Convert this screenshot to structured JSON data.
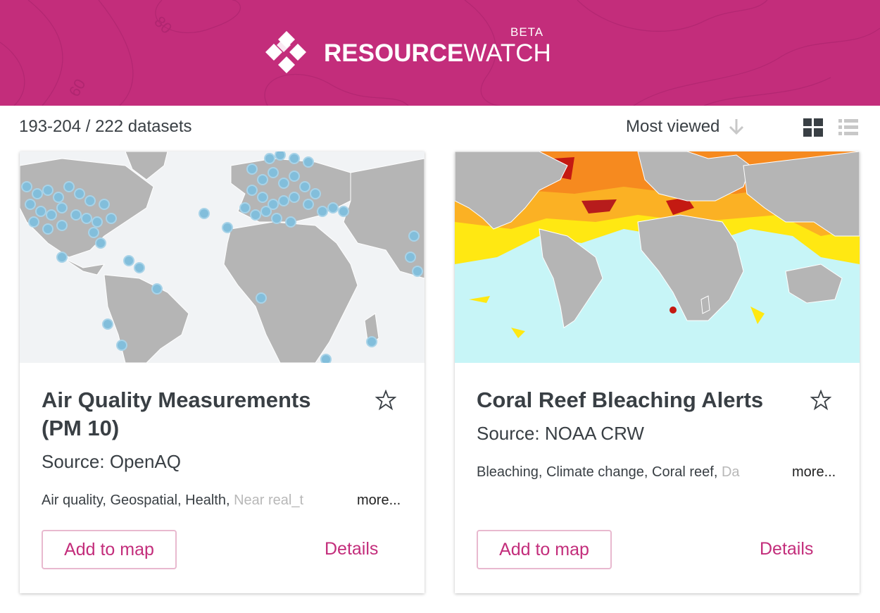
{
  "header": {
    "brand_bold": "RESOURCE",
    "brand_light": "WATCH",
    "badge": "BETA",
    "background": "#c32d7b",
    "contour_labels": [
      "80",
      "60"
    ]
  },
  "toolbar": {
    "count": "193-204 / 222 datasets",
    "sort_label": "Most viewed",
    "sort_icon": "arrow-down-icon",
    "view_grid_icon": "grid-view-icon",
    "view_list_icon": "list-view-icon"
  },
  "cards": [
    {
      "title": "Air Quality Measurements (PM 10)",
      "source": "Source: OpenAQ",
      "tags": "Air quality,  Geospatial,  Health,  ",
      "tags_faded": "Near real_t",
      "more": "more...",
      "add": "Add to map",
      "details": "Details"
    },
    {
      "title": "Coral Reef Bleaching Alerts",
      "source": "Source: NOAA CRW",
      "tags": "Bleaching,  Climate change,  Coral reef,  ",
      "tags_faded": "Da",
      "more": "more...",
      "add": "Add to map",
      "details": "Details"
    }
  ],
  "colors": {
    "accent": "#c32d7b",
    "text": "#393f44",
    "land": "#b5b5b5",
    "ocean_light": "#f1f3f5",
    "ocean_cyan": "#c7f5f7",
    "point": "#82bedb"
  }
}
